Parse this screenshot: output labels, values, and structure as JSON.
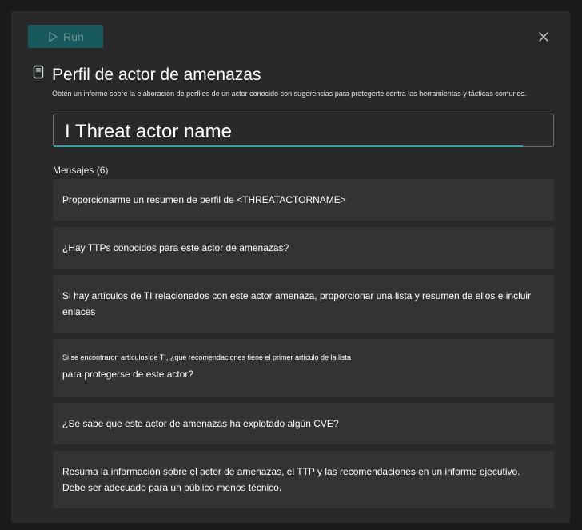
{
  "toolbar": {
    "run_label": "Run"
  },
  "header": {
    "title": "Perfil de actor de amenazas",
    "subtitle": "Obtén un informe sobre la elaboración de perfiles de un actor conocido con sugerencias para protegerte contra las herramientas y tácticas comunes."
  },
  "input": {
    "value": "I Threat actor name"
  },
  "messages_label": "Mensajes (6)",
  "messages": [
    {
      "text": "Proporcionarme un resumen de perfil de <THREATACTORNAME>"
    },
    {
      "text": "¿Hay TTPs conocidos para este actor de amenazas?"
    },
    {
      "line1": "Si hay artículos de TI relacionados con este actor amenaza, proporcionar una lista y resumen de ellos e incluir",
      "line2": "enlaces"
    },
    {
      "line1": "Si se encontraron artículos de TI, ¿qué recomendaciones tiene el primer artículo de la lista",
      "line2": "para protegerse de este actor?"
    },
    {
      "text": "¿Se sabe que este actor de amenazas ha explotado algún CVE?"
    },
    {
      "line1": "Resuma la información sobre el actor de amenazas, el TTP y las recomendaciones en un informe ejecutivo.",
      "line2": "Debe ser adecuado para un público menos técnico."
    }
  ],
  "colors": {
    "accent": "#3aa0a8",
    "run_button_bg": "#17585c",
    "dialog_bg": "#292929",
    "card_bg": "#333333"
  },
  "icons": {
    "run": "play-icon",
    "close": "close-icon",
    "prompt": "promptbook-icon"
  }
}
